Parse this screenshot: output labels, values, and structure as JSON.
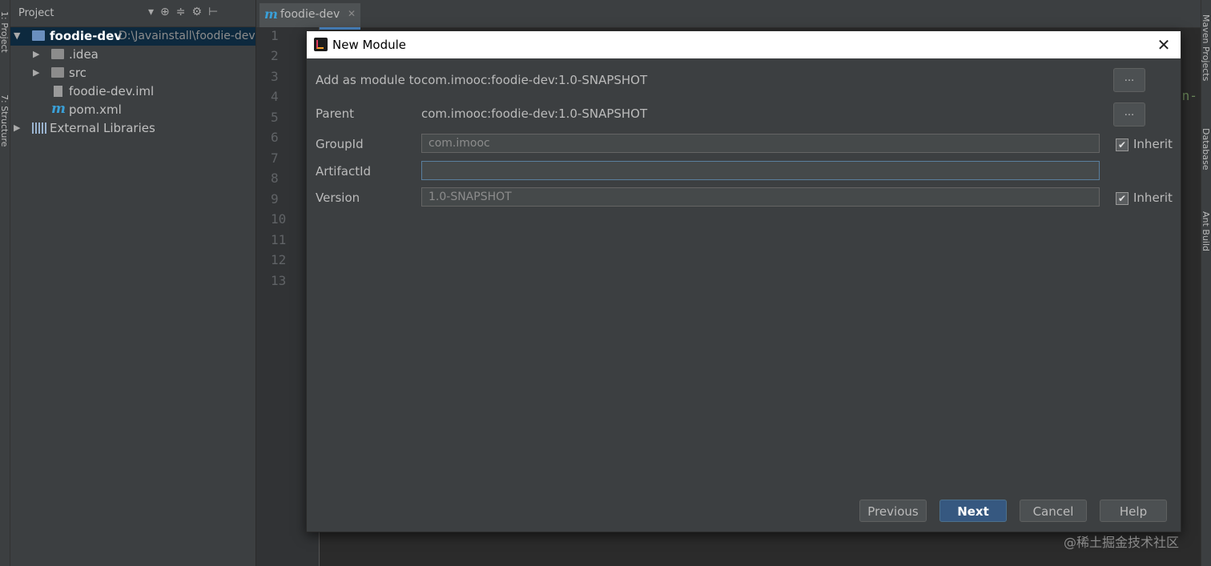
{
  "left_tabs": [
    "1: Project",
    "7: Structure"
  ],
  "right_tabs": [
    "Maven Projects",
    "Database",
    "Ant Build"
  ],
  "project_panel": {
    "title": "Project",
    "tree": [
      {
        "label": "foodie-dev",
        "path": "D:\\Javainstall\\foodie-dev",
        "icon": "module-folder-icon",
        "expanded": true,
        "depth": 0,
        "selected": true
      },
      {
        "label": ".idea",
        "icon": "folder-icon",
        "depth": 1
      },
      {
        "label": "src",
        "icon": "folder-icon",
        "depth": 1
      },
      {
        "label": "foodie-dev.iml",
        "icon": "iml-file-icon",
        "depth": 1
      },
      {
        "label": "pom.xml",
        "icon": "maven-icon",
        "depth": 1
      },
      {
        "label": "External Libraries",
        "icon": "libraries-icon",
        "depth": 0
      }
    ]
  },
  "editor": {
    "tab_label": "foodie-dev",
    "line_numbers": [
      "1",
      "2",
      "3",
      "4",
      "5",
      "6",
      "7",
      "8",
      "9",
      "10",
      "11",
      "12",
      "13"
    ],
    "code_fragment": "en-"
  },
  "dialog": {
    "title": "New Module",
    "add_as_module_label": "Add as module to",
    "add_as_module_value": "com.imooc:foodie-dev:1.0-SNAPSHOT",
    "parent_label": "Parent",
    "parent_value": "com.imooc:foodie-dev:1.0-SNAPSHOT",
    "browse_label": "...",
    "groupid_label": "GroupId",
    "groupid_value": "com.imooc",
    "artifactid_label": "ArtifactId",
    "artifactid_value": "",
    "version_label": "Version",
    "version_value": "1.0-SNAPSHOT",
    "inherit_label": "Inherit",
    "groupid_inherit": true,
    "version_inherit": true,
    "buttons": {
      "previous": "Previous",
      "next": "Next",
      "cancel": "Cancel",
      "help": "Help"
    }
  },
  "watermark": "@稀土掘金技术社区"
}
